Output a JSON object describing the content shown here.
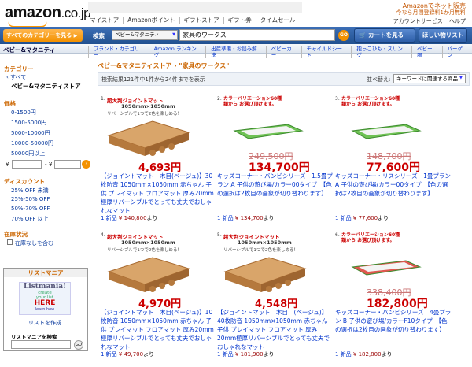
{
  "header": {
    "logo_main": "amazon",
    "logo_tld": ".co.jp",
    "top_nav": [
      "マイストア",
      "Amazonポイント",
      "ギフトストア",
      "ギフト券",
      "タイムセール"
    ],
    "promo_line1": "Amazonでネット販売",
    "promo_line2": "今なら月間登録料1か月無料",
    "account_links": [
      "アカウントサービス",
      "ヘルプ"
    ],
    "category_button": "すべてのカテゴリーを見る",
    "search_label": "検索",
    "search_select": "ベビー&マタニティ",
    "search_value": "家具のワークス",
    "go_label": "GO",
    "cart_label": "カートを見る",
    "wish_label": "ほしい物リスト"
  },
  "store_name": "ベビー&マタニティ",
  "sub_nav": [
    "ブランド・カテゴリー",
    "Amazon ランキング",
    "出産準備・お悩み解決",
    "ベビーカー",
    "チャイルドシート",
    "抱っこひも・スリング",
    "ベビー服",
    "バーゲン"
  ],
  "sidebar": {
    "category_head": "カテゴリー",
    "all": "‹ すべて",
    "current": "ベビー&マタニティストア",
    "price_head": "価格",
    "prices": [
      "0-1500円",
      "1500-5000円",
      "5000-10000円",
      "10000-50000円",
      "50000円以上"
    ],
    "yen": "¥",
    "dash": "-",
    "discount_head": "ディスカウント",
    "discounts": [
      "25% OFF 未満",
      "25%-50% OFF",
      "50%-70% OFF",
      "70% OFF 以上"
    ],
    "stock_head": "在庫状況",
    "stock_option": "在庫なしを含む",
    "listmania_head": "リストマニア",
    "listmania_logo": "Listmania!",
    "listmania_sub1": "create",
    "listmania_sub2": "your list",
    "listmania_here": "HERE",
    "listmania_learn": "learn how",
    "listmania_create": "リストを作成",
    "listmania_search": "リストマニアを検索"
  },
  "breadcrumb": "ベビー&マタニティストア › \"家具のワークス\"",
  "results_text": "検索結果121件中1件から24件までを表示",
  "sort_label": "並べ替え:",
  "sort_value": "キーワードに関連する商品",
  "products": [
    {
      "num": "1.",
      "banner": "超大判ジョイントマット",
      "size": "1050mm×1050mm",
      "sub": "リバーシブルで1つで2色を楽しめる！",
      "price_big": "4,693円",
      "title": "【ジョイントマット　木目(ベージュ)】30枚防音 1050mm×1050mm 赤ちゃん 子供 プレイマット フロアマット 厚み20mm極厚リバーシブルでとっても丈夫でおしゃれなマット",
      "new": "1 新品",
      "newprice": "¥ 140,800",
      "suffix": "より",
      "color": "#c88b4f"
    },
    {
      "num": "2.",
      "banner": "カラーバリエーション60種類から お選び頂けます。",
      "size": "",
      "sub": "",
      "price_strike": "249,500円",
      "price_big": "134,700円",
      "title": "キッズコーナー・バンビシリーズ　1.5畳プラン A 子供の遊び場/カラー00タイプ　【色の選択は2枚目の画象が切り替わります】",
      "new": "1 新品",
      "newprice": "¥ 134,700",
      "suffix": "より",
      "color": "#6fc254"
    },
    {
      "num": "3.",
      "banner": "カラーバリエーション60種類から お選び頂けます。",
      "size": "",
      "sub": "",
      "price_strike": "148,700円",
      "price_big": "77,600円",
      "title": "キッズコーナー・リスシリーズ　1畳プランA 子供の遊び場/カラー00タイプ　【色の選択は2枚目の画象が切り替わります】",
      "new": "1 新品",
      "newprice": "¥ 77,600",
      "suffix": "より",
      "color": "#6fc254"
    },
    {
      "num": "4.",
      "banner": "超大判ジョイントマット",
      "size": "1050mm×1050mm",
      "sub": "リバーシブルで1つで2色を楽しめる！",
      "price_big": "4,970円",
      "title": "【ジョイントマット　木目(ベージュ)】10枚防音 1050mm×1050mm 赤ちゃん 子供 プレイマット フロアマット 厚み20mm極厚リバーシブルでとっても丈夫でおしゃれなマット",
      "new": "1 新品",
      "newprice": "¥ 49,700",
      "suffix": "より",
      "color": "#c88b4f"
    },
    {
      "num": "5.",
      "banner": "超大判ジョイントマット",
      "size": "1050mm×1050mm",
      "sub": "リバーシブルで1つで2色を楽しめる！",
      "price_big": "4,548円",
      "title": "【ジョイントマット　木目　(ベージュ)】40枚防音 1050mm×1050mm 赤ちゃん 子供 プレイマット フロアマット 厚み20mm極厚リバーシブルでとっても丈夫でおしゃれなマット",
      "new": "1 新品",
      "newprice": "¥ 181,900",
      "suffix": "より",
      "color": "#c88b4f"
    },
    {
      "num": "6.",
      "banner": "カラーバリエーション60種類から お選び頂けます。",
      "size": "",
      "sub": "",
      "price_strike": "338,400円",
      "price_big": "182,800円",
      "title": "キッズコーナー・バンビシリーズ　4畳プラン B 子供の遊び場/カラーF10タイプ　【色の選択は2枚目の画象が切り替わります】",
      "new": "1 新品",
      "newprice": "¥ 182,800",
      "suffix": "より",
      "color": "#e0574f"
    }
  ]
}
